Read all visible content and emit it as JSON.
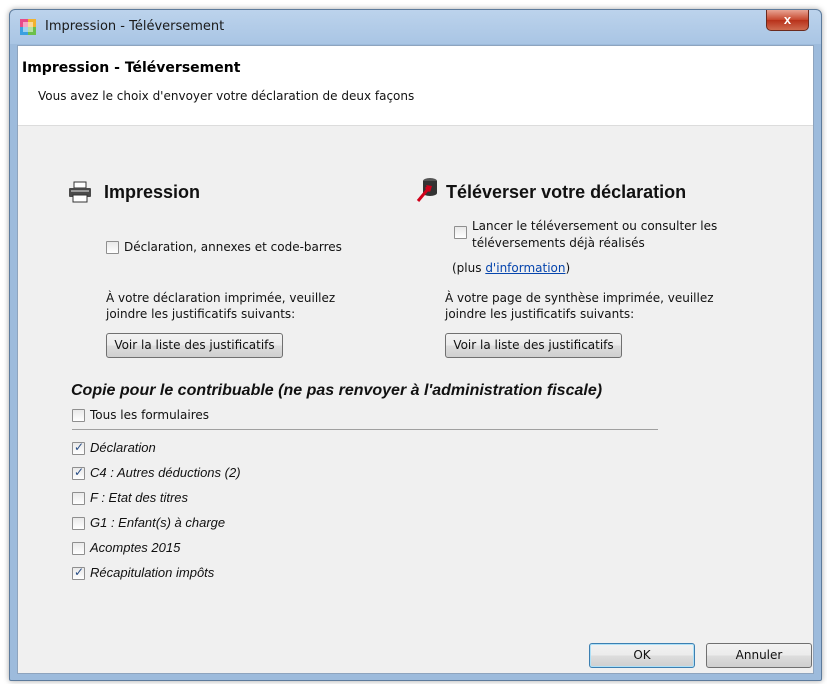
{
  "window": {
    "title": "Impression - Téléversement",
    "close_label": "x"
  },
  "header": {
    "title": "Impression - Téléversement",
    "description": "Vous avez le choix d'envoyer votre déclaration de deux façons"
  },
  "impression": {
    "title": "Impression",
    "checkbox_label": "Déclaration, annexes et code-barres",
    "checked": false,
    "note_line1": "À votre déclaration imprimée, veuillez",
    "note_line2": "joindre les justificatifs suivants:",
    "button_label": "Voir la liste des justificatifs"
  },
  "upload": {
    "title": "Téléverser votre déclaration",
    "checkbox_label_line1": "Lancer le téléversement ou consulter les",
    "checkbox_label_line2": "téléversements déjà réalisés",
    "checked": false,
    "more_prefix": "(plus ",
    "more_link": "d'information",
    "more_suffix": ")",
    "note_line1": "À votre page de synthèse imprimée, veuillez",
    "note_line2": "joindre les justificatifs suivants:",
    "button_label": "Voir la liste des justificatifs"
  },
  "copy": {
    "title": "Copie pour le contribuable (ne pas renvoyer à l'administration fiscale)",
    "all_label": "Tous les formulaires",
    "all_checked": false,
    "items": [
      {
        "label": "Déclaration",
        "checked": true
      },
      {
        "label": "C4 : Autres déductions (2)",
        "checked": true
      },
      {
        "label": "F : Etat des titres",
        "checked": false
      },
      {
        "label": "G1 : Enfant(s) à charge",
        "checked": false
      },
      {
        "label": "Acomptes 2015",
        "checked": false
      },
      {
        "label": "Récapitulation impôts",
        "checked": true
      }
    ]
  },
  "footer": {
    "ok_label": "OK",
    "cancel_label": "Annuler"
  }
}
